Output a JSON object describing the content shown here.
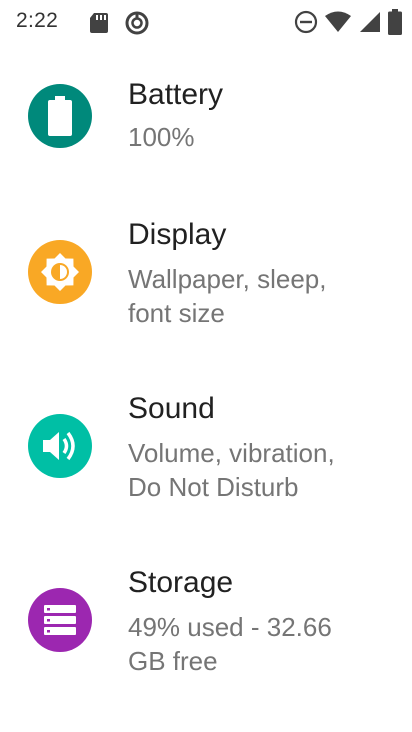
{
  "status_bar": {
    "time": "2:22",
    "left_icons": [
      "sd-card-icon",
      "sync-circle-icon"
    ],
    "right_icons": [
      "do-not-disturb-icon",
      "wifi-icon",
      "cell-signal-icon",
      "battery-icon"
    ]
  },
  "settings": {
    "items": [
      {
        "title": "Battery",
        "summary": "100%",
        "icon": "battery-icon",
        "color": "#00897B"
      },
      {
        "title": "Display",
        "summary": "Wallpaper, sleep, font size",
        "icon": "brightness-icon",
        "color": "#F9A825"
      },
      {
        "title": "Sound",
        "summary": "Volume, vibration, Do Not Disturb",
        "icon": "volume-icon",
        "color": "#00BFA5"
      },
      {
        "title": "Storage",
        "summary": "49% used - 32.66 GB free",
        "icon": "storage-icon",
        "color": "#9C27B0"
      }
    ]
  }
}
